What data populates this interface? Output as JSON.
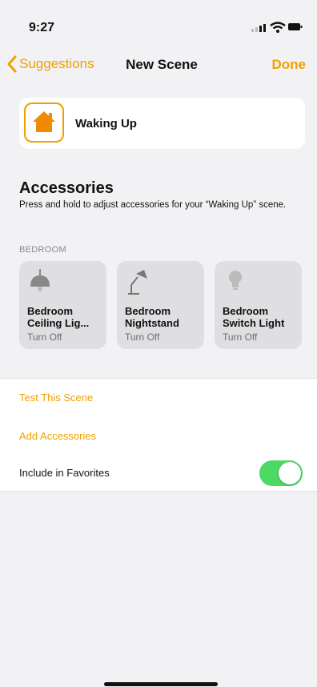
{
  "status_bar": {
    "time": "9:27"
  },
  "nav": {
    "back_label": "Suggestions",
    "title": "New Scene",
    "done_label": "Done"
  },
  "scene": {
    "name": "Waking Up",
    "icon": "house-icon"
  },
  "accessories": {
    "heading": "Accessories",
    "description": "Press and hold to adjust accessories for your “Waking Up” scene.",
    "room": "BEDROOM",
    "tiles": [
      {
        "name": "Bedroom\nCeiling Lig...",
        "status": "Turn Off",
        "icon": "ceiling-light-icon"
      },
      {
        "name": "Bedroom\nNightstand",
        "status": "Turn Off",
        "icon": "desk-lamp-icon"
      },
      {
        "name": "Bedroom\nSwitch Light",
        "status": "Turn Off",
        "icon": "light-bulb-icon"
      }
    ]
  },
  "actions": {
    "test_scene": "Test This Scene",
    "add_accessories": "Add Accessories",
    "favorites_label": "Include in Favorites",
    "favorites_on": true
  },
  "colors": {
    "accent": "#f0a000",
    "toggle_on": "#4cd964"
  }
}
